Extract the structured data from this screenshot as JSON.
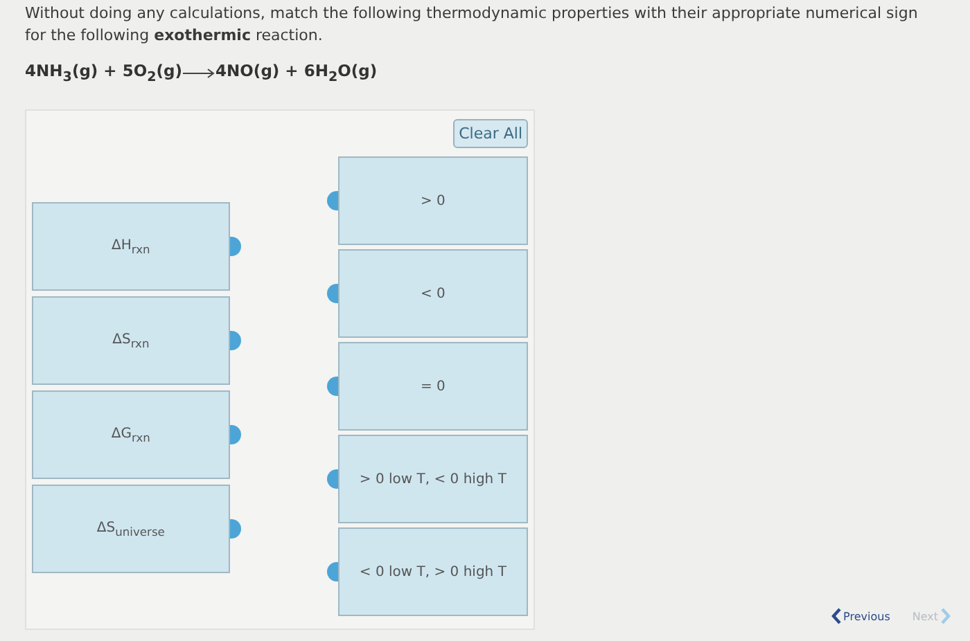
{
  "question": "Without doing any calculations, match the following thermodynamic properties with their appropriate numerical sign for the following **exothermic** reaction.",
  "equation": {
    "reactants": "4NH$_{3}$(g) + 5O$_{2}$(g)",
    "products": "4NO(g) + 6H$_{2}$O(g)"
  },
  "clear_button": "Clear All",
  "properties": [
    {
      "label": "ΔH$_{rxn}$"
    },
    {
      "label": "ΔS$_{rxn}$"
    },
    {
      "label": "ΔG$_{rxn}$"
    },
    {
      "label": "ΔS$_{universe}$"
    }
  ],
  "signs": [
    {
      "label": "> 0"
    },
    {
      "label": "< 0"
    },
    {
      "label": "= 0"
    },
    {
      "label": "> 0 low T, < 0 high T"
    },
    {
      "label": "< 0 low T, > 0 high T"
    }
  ],
  "navigation": [
    {
      "label": "Previous",
      "disabled": false,
      "kind": "previous"
    },
    {
      "label": "Next",
      "disabled": true,
      "kind": "next"
    }
  ]
}
